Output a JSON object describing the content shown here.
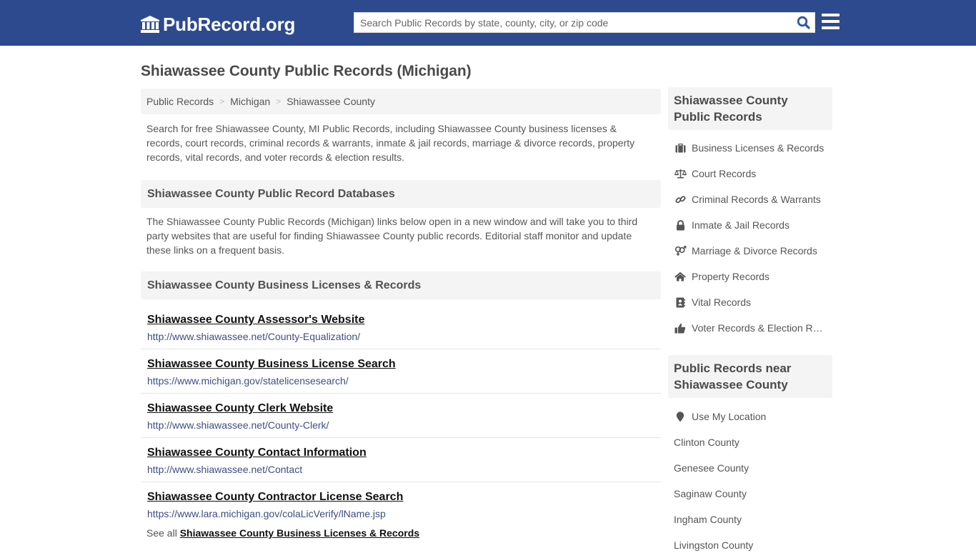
{
  "header": {
    "logo_text": "PubRecord.org",
    "search_placeholder": "Search Public Records by state, county, city, or zip code",
    "brand_color": "#2e4a8e"
  },
  "page_title": "Shiawassee County Public Records (Michigan)",
  "breadcrumb": [
    {
      "label": "Public Records"
    },
    {
      "label": "Michigan"
    },
    {
      "label": "Shiawassee County"
    }
  ],
  "breadcrumb_separator": ">",
  "intro": "Search for free Shiawassee County, MI Public Records, including Shiawassee County business licenses & records, court records, criminal records & warrants, inmate & jail records, marriage & divorce records, property records, vital records, and voter records & election results.",
  "databases_section": {
    "heading": "Shiawassee County Public Record Databases",
    "description": "The Shiawassee County Public Records (Michigan) links below open in a new window and will take you to third party websites that are useful for finding Shiawassee County public records. Editorial staff monitor and update these links on a frequent basis."
  },
  "business_section": {
    "heading": "Shiawassee County Business Licenses & Records",
    "links": [
      {
        "title": "Shiawassee County Assessor's Website",
        "url": "http://www.shiawassee.net/County-Equalization/"
      },
      {
        "title": "Shiawassee County Business License Search",
        "url": "https://www.michigan.gov/statelicensesearch/"
      },
      {
        "title": "Shiawassee County Clerk Website",
        "url": "http://www.shiawassee.net/County-Clerk/"
      },
      {
        "title": "Shiawassee County Contact Information",
        "url": "http://www.shiawassee.net/Contact"
      },
      {
        "title": "Shiawassee County Contractor License Search",
        "url": "https://www.lara.michigan.gov/colaLicVerify/lName.jsp"
      }
    ],
    "see_all_prefix": "See all",
    "see_all_link": "Shiawassee County Business Licenses & Records"
  },
  "sidebar": {
    "records_heading": "Shiawassee County Public Records",
    "records": [
      {
        "icon": "briefcase-icon",
        "label": "Business Licenses & Records"
      },
      {
        "icon": "balance-scale-icon",
        "label": "Court Records"
      },
      {
        "icon": "link-icon",
        "label": "Criminal Records & Warrants"
      },
      {
        "icon": "lock-icon",
        "label": "Inmate & Jail Records"
      },
      {
        "icon": "venus-mars-icon",
        "label": "Marriage & Divorce Records"
      },
      {
        "icon": "home-icon",
        "label": "Property Records"
      },
      {
        "icon": "address-book-icon",
        "label": "Vital Records"
      },
      {
        "icon": "thumbs-up-icon",
        "label": "Voter Records & Election Results"
      }
    ],
    "near_heading": "Public Records near Shiawassee County",
    "use_location": "Use My Location",
    "nearby": [
      {
        "label": "Clinton County"
      },
      {
        "label": "Genesee County"
      },
      {
        "label": "Saginaw County"
      },
      {
        "label": "Ingham County"
      },
      {
        "label": "Livingston County"
      }
    ]
  }
}
